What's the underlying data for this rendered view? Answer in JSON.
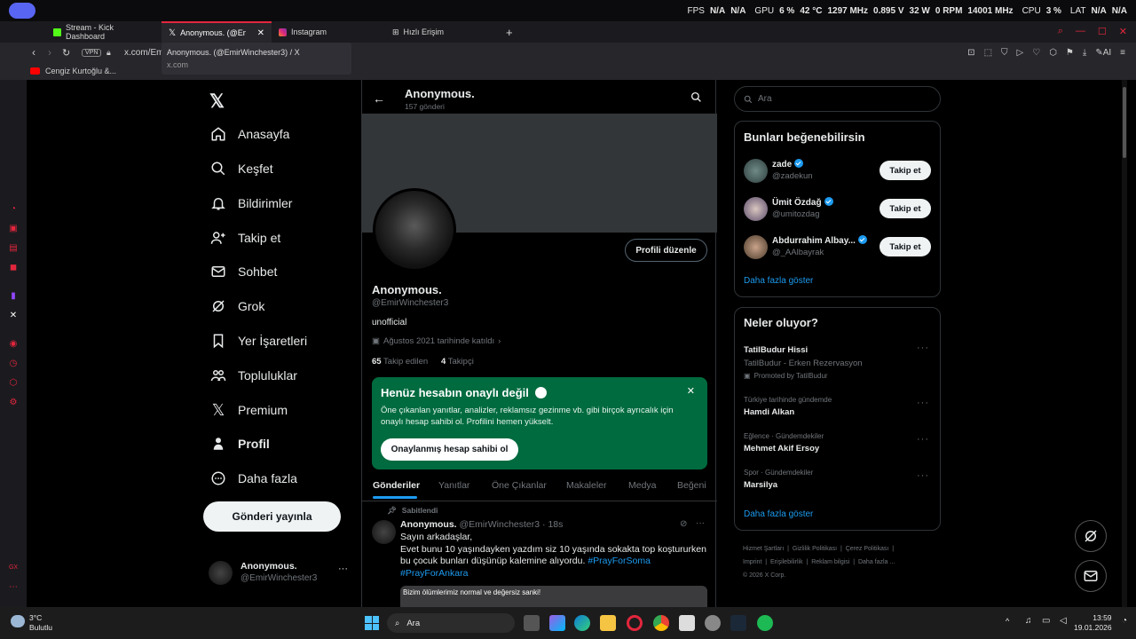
{
  "overlay": {
    "fps_label": "FPS",
    "fps_value": "N/A",
    "fps_value2": "N/A",
    "gpu_label": "GPU",
    "gpu_usage": "6 %",
    "gpu_temp": "42 °C",
    "gpu_clock": "1297 MHz",
    "gpu_voltage": "0.895 V",
    "gpu_power": "32 W",
    "gpu_fan": "0 RPM",
    "gpu_mem_clock": "14001 MHz",
    "cpu_label": "CPU",
    "cpu_usage": "3 %",
    "lat_label": "LAT",
    "lat_value": "N/A",
    "lat_value2": "N/A"
  },
  "browser": {
    "tabs": [
      {
        "label": "Stream - Kick Dashboard"
      },
      {
        "label": "Anonymous. (@EmirW"
      },
      {
        "label": "Instagram"
      },
      {
        "label": "Hızlı Erişim"
      }
    ],
    "vpn_label": "VPN",
    "address": "x.com/Emi",
    "tooltip_title": "Anonymous. (@EmirWinchester3) / X",
    "tooltip_url": "x.com",
    "bookmark_label": "Cengiz Kurtoğlu &...",
    "ai_label": "AI"
  },
  "nav": {
    "items": [
      {
        "label": "Anasayfa",
        "icon": "home-icon"
      },
      {
        "label": "Keşfet",
        "icon": "search-icon"
      },
      {
        "label": "Bildirimler",
        "icon": "bell-icon"
      },
      {
        "label": "Takip et",
        "icon": "follow-icon"
      },
      {
        "label": "Sohbet",
        "icon": "mail-icon"
      },
      {
        "label": "Grok",
        "icon": "grok-icon"
      },
      {
        "label": "Yer İşaretleri",
        "icon": "bookmark-icon"
      },
      {
        "label": "Topluluklar",
        "icon": "communities-icon"
      },
      {
        "label": "Premium",
        "icon": "x-logo-icon"
      },
      {
        "label": "Profil",
        "icon": "person-icon"
      },
      {
        "label": "Daha fazla",
        "icon": "more-circle-icon"
      }
    ],
    "post_button": "Gönderi yayınla",
    "account_name": "Anonymous.",
    "account_handle": "@EmirWinchester3"
  },
  "profile": {
    "header_name": "Anonymous.",
    "header_posts": "157 gönderi",
    "edit_button": "Profili düzenle",
    "name": "Anonymous.",
    "handle": "@EmirWinchester3",
    "bio": "unofficial",
    "joined": "Ağustos 2021 tarihinde katıldı",
    "following_count": "65",
    "following_label": "Takip edilen",
    "followers_count": "4",
    "followers_label": "Takipçi",
    "verify_title": "Henüz hesabın onaylı değil",
    "verify_text": "Öne çıkanlan yanıtlar, analizler, reklamsız gezinme vb. gibi birçok ayrıcalık için onaylı hesap sahibi ol. Profilini hemen yükselt.",
    "verify_button": "Onaylanmış hesap sahibi ol",
    "tabs": [
      "Gönderiler",
      "Yanıtlar",
      "Öne Çıkanlar",
      "Makaleler",
      "Medya",
      "Beğeni"
    ]
  },
  "post": {
    "pinned_label": "Sabitlendi",
    "author": "Anonymous.",
    "meta": "@EmirWinchester3 · 18s",
    "line1": "Sayın arkadaşlar,",
    "line2": "Evet bunu 10 yaşındayken yazdım siz 10 yaşında sokakta top koştururken",
    "line3a": "bu çocuk bunları düşünüp kalemine alıyordu. ",
    "hashtag1": "#PrayForSoma",
    "hashtag2": "#PrayForAnkara",
    "image_caption": "Bizim ölümlerimiz normal ve değersiz sanki!"
  },
  "right": {
    "search_placeholder": "Ara",
    "suggest_title": "Bunları beğenebilirsin",
    "suggestions": [
      {
        "name": "zade",
        "handle": "@zadekun",
        "button": "Takip et"
      },
      {
        "name": "Ümit Özdağ",
        "handle": "@umitozdag",
        "button": "Takip et"
      },
      {
        "name": "Abdurrahim Albay...",
        "handle": "@_AAlbayrak",
        "button": "Takip et"
      }
    ],
    "show_more": "Daha fazla göster",
    "trends_title": "Neler oluyor?",
    "trends": [
      {
        "context": "",
        "title": "TatilBudur Hissi",
        "sub": "TatilBudur - Erken Rezervasyon",
        "promo": "Promoted by TatilBudur"
      },
      {
        "context": "Türkiye tarihinde gündemde",
        "title": "Hamdi Alkan"
      },
      {
        "context": "Eğlence · Gündemdekiler",
        "title": "Mehmet Akif Ersoy"
      },
      {
        "context": "Spor · Gündemdekiler",
        "title": "Marsilya"
      }
    ],
    "trends_more": "Daha fazla göster",
    "footer": [
      "Hizmet Şartları",
      "Gizlilik Politikası",
      "Çerez Politikası",
      "Imprint",
      "Erişilebilirlik",
      "Reklam bilgisi",
      "Daha fazla ...",
      "© 2026 X Corp."
    ]
  },
  "taskbar": {
    "weather_temp": "3°C",
    "weather_desc": "Bulutlu",
    "search_placeholder": "Ara",
    "time": "13:59",
    "date": "19.01.2026"
  }
}
